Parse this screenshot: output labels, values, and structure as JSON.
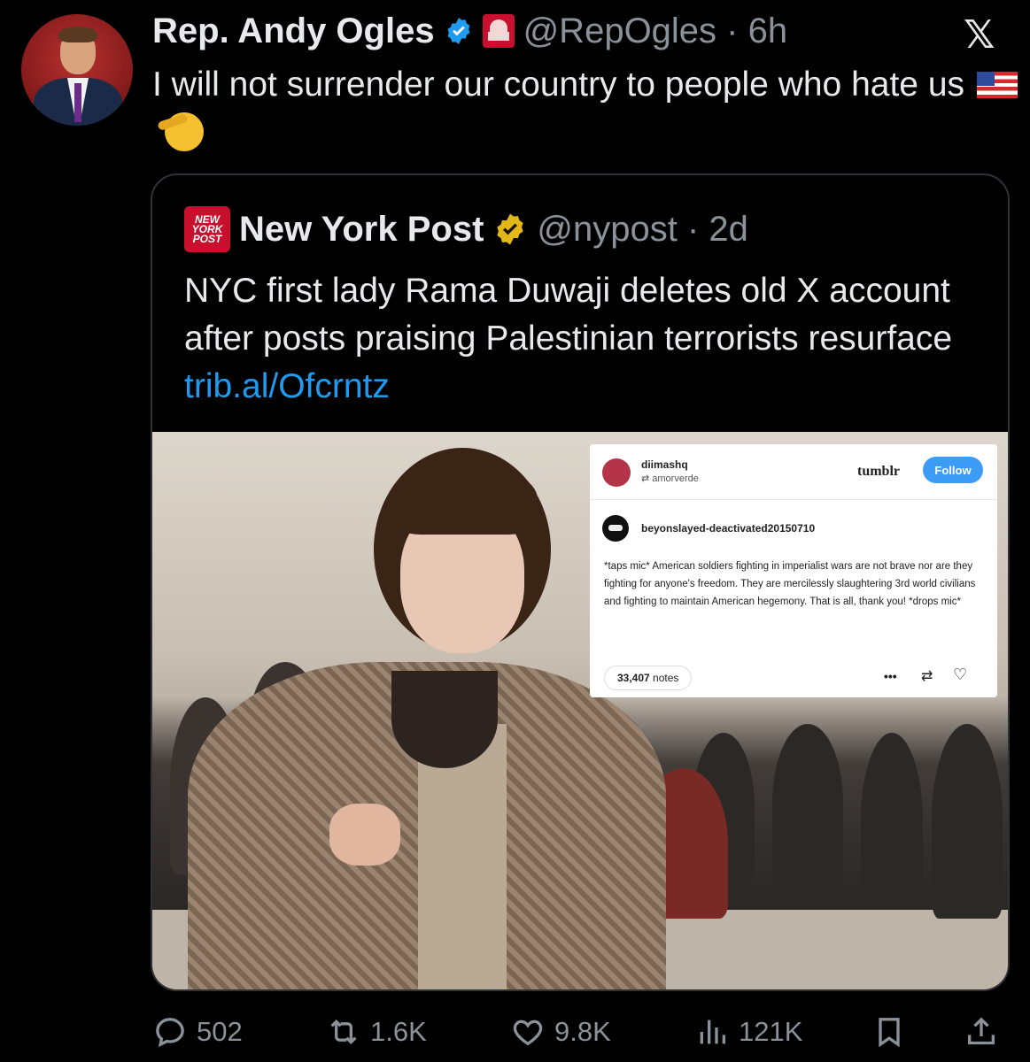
{
  "author": {
    "name": "Rep. Andy Ogles",
    "handle": "@RepOgles",
    "time": "6h"
  },
  "tweet": {
    "text": "I will not surrender our country to people who hate us"
  },
  "quote": {
    "logo": [
      "NEW",
      "YORK",
      "POST"
    ],
    "name": "New York Post",
    "handle": "@nypost",
    "time": "2d",
    "text": "NYC first lady Rama Duwaji deletes old X account after posts praising Palestinian terrorists resurface",
    "link": "trib.al/Ofcrntz"
  },
  "tumblr": {
    "user": "diimashq",
    "reblogged_from": "amorverde",
    "brand": "tumblr",
    "follow": "Follow",
    "op": "beyonslayed-deactivated20150710",
    "body": "*taps mic* American soldiers fighting in imperialist wars are not brave nor are they fighting for anyone's freedom. They are mercilessly slaughtering 3rd world civilians and fighting to maintain American hegemony. That is all, thank you! *drops mic*",
    "notes_count": "33,407",
    "notes_label": "notes",
    "more": "•••"
  },
  "actions": {
    "replies": "502",
    "reposts": "1.6K",
    "likes": "9.8K",
    "views": "121K"
  },
  "colors": {
    "background": "#000000",
    "text": "#e7e9ea",
    "secondary": "#8b9198",
    "link": "#1d9bf0",
    "verified": "#1d9bf0",
    "gold_check": "#e2b719",
    "nypost_red": "#c8102e"
  }
}
